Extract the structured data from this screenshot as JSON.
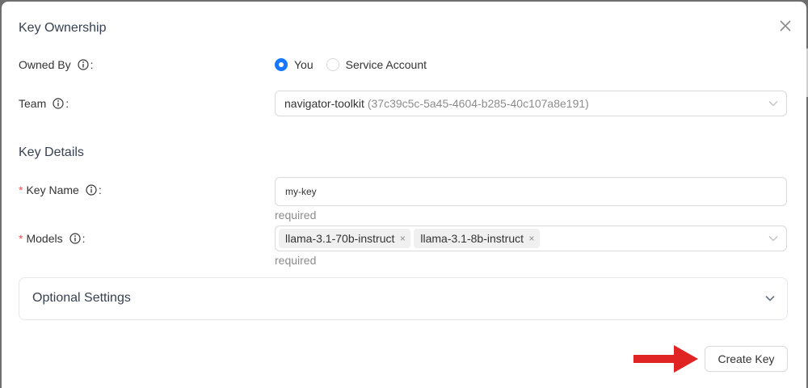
{
  "modal": {
    "sections": {
      "ownership_title": "Key Ownership",
      "details_title": "Key Details"
    },
    "owned_by": {
      "label": "Owned By",
      "colon": ":",
      "options": [
        {
          "label": "You",
          "selected": true
        },
        {
          "label": "Service Account",
          "selected": false
        }
      ]
    },
    "team": {
      "label": "Team",
      "colon": ":",
      "selected_name": "navigator-toolkit",
      "selected_id": "(37c39c5c-5a45-4604-b285-40c107a8e191)"
    },
    "key_name": {
      "required_mark": "*",
      "label": "Key Name",
      "colon": ":",
      "value": "my-key",
      "help": "required"
    },
    "models": {
      "required_mark": "*",
      "label": "Models",
      "colon": ":",
      "tags": [
        "llama-3.1-70b-instruct",
        "llama-3.1-8b-instruct"
      ],
      "help": "required",
      "tag_close": "×"
    },
    "optional_settings": {
      "title": "Optional Settings"
    },
    "actions": {
      "create_label": "Create Key"
    }
  },
  "colors": {
    "accent": "#1677ff",
    "required": "#ff4d4f",
    "annotation_arrow": "#e02424"
  },
  "icons": [
    "close-icon",
    "info-icon",
    "chevron-down-icon",
    "arrow-right-annotation"
  ]
}
